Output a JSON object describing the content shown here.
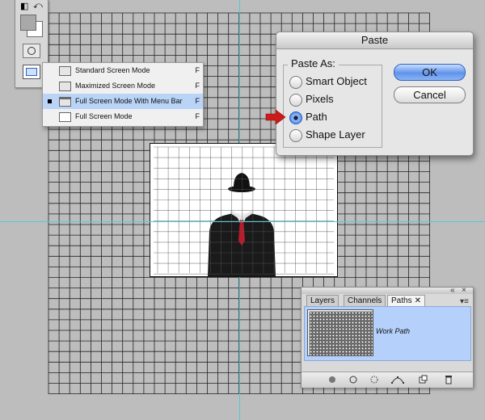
{
  "colors": {
    "workspace": "#bdbdbd",
    "guide": "#58c7d6",
    "selection": "#b9d4f7",
    "primary_button": "#5f93ea",
    "arrow": "#cc1b1b"
  },
  "menu": {
    "items": [
      {
        "label": "Standard Screen Mode",
        "shortcut": "F",
        "selected": false,
        "icon": "standard-screen-icon"
      },
      {
        "label": "Maximized Screen Mode",
        "shortcut": "F",
        "selected": false,
        "icon": "maximized-screen-icon"
      },
      {
        "label": "Full Screen Mode With Menu Bar",
        "shortcut": "F",
        "selected": true,
        "icon": "full-screen-menu-icon"
      },
      {
        "label": "Full Screen Mode",
        "shortcut": "F",
        "selected": false,
        "icon": "full-screen-icon"
      }
    ]
  },
  "dialog": {
    "title": "Paste",
    "group_label": "Paste As:",
    "options": [
      {
        "label": "Smart Object",
        "checked": false
      },
      {
        "label": "Pixels",
        "checked": false
      },
      {
        "label": "Path",
        "checked": true
      },
      {
        "label": "Shape Layer",
        "checked": false
      }
    ],
    "ok_label": "OK",
    "cancel_label": "Cancel"
  },
  "panel": {
    "tabs": [
      {
        "label": "Layers",
        "active": false
      },
      {
        "label": "Channels",
        "active": false
      },
      {
        "label": "Paths",
        "active": true
      }
    ],
    "close_glyph": "✕",
    "path_name": "Work Path",
    "toolbar_icons": [
      "fill-path-icon",
      "stroke-path-icon",
      "load-selection-icon",
      "make-work-path-icon",
      "new-path-icon",
      "delete-path-icon"
    ]
  },
  "toolbox": {
    "icons": [
      "default-colors-icon",
      "swap-colors-icon",
      "foreground-color-swatch",
      "background-color-swatch",
      "quick-mask-icon",
      "screen-mode-icon"
    ]
  }
}
